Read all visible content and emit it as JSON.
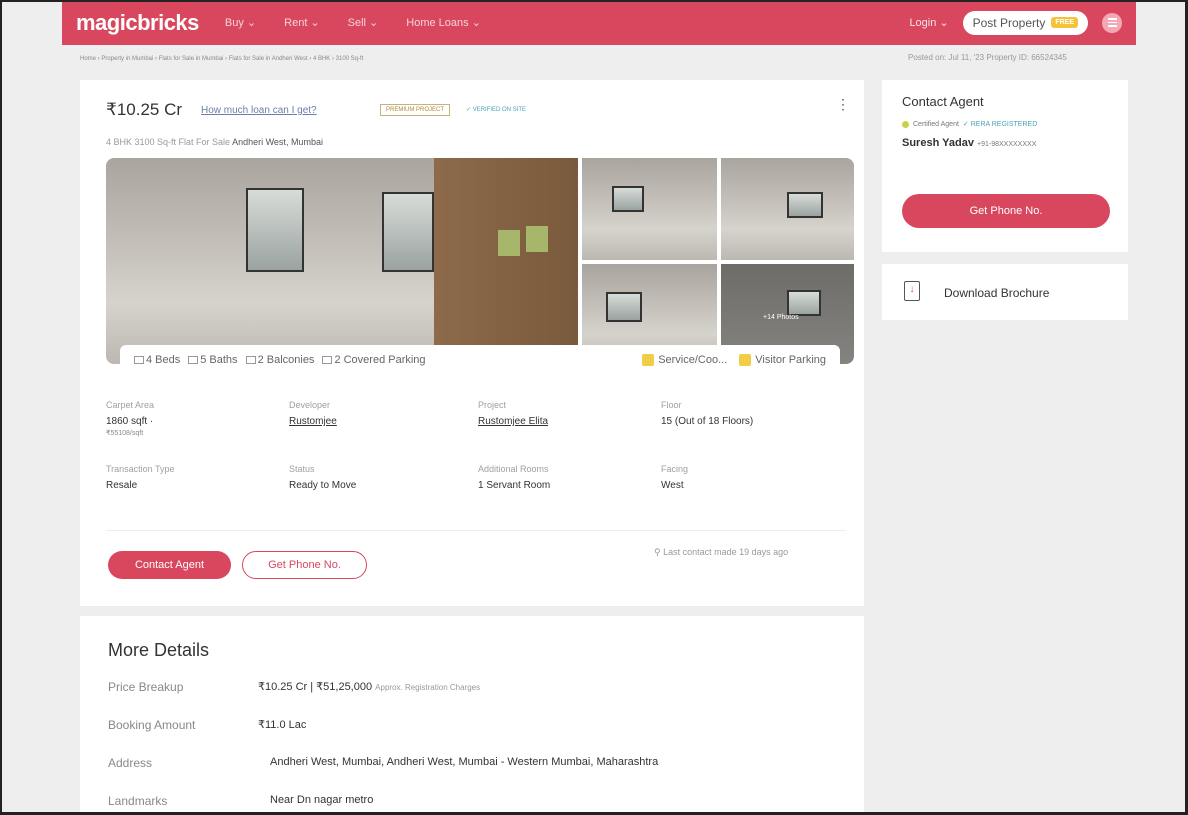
{
  "header": {
    "logo": "magicbricks",
    "nav": [
      "Buy ⌄",
      "Rent ⌄",
      "Sell ⌄",
      "Home Loans ⌄"
    ],
    "login": "Login ⌄",
    "post_property": "Post Property",
    "free_badge": "FREE"
  },
  "breadcrumb": "Home › Property in Mumbai › Flats for Sale in Mumbai › Flats for Sale in Andheri West › 4 BHK › 3100 Sq-ft",
  "posted": "Posted on: Jul 11, '23    Property ID: 66524345",
  "listing": {
    "price": "₹10.25 Cr",
    "loan_link": "How much loan can I get?",
    "premium_badge": "PREMIUM PROJECT",
    "verified_badge": "✓ VERIFIED ON SITE",
    "subtitle_prefix": "4 BHK 3100 Sq-ft Flat For Sale",
    "subtitle_location": "Andheri West, Mumbai",
    "more_photos": "+14 Photos",
    "amenities_left": [
      "4 Beds",
      "5 Baths",
      "2 Balconies",
      "2 Covered Parking"
    ],
    "amenities_right": [
      "Service/Coo...",
      "Visitor Parking"
    ],
    "facts": [
      {
        "label": "Carpet Area",
        "value": "1860 sqft ·",
        "sub": "₹55108/sqft"
      },
      {
        "label": "Developer",
        "value": "Rustomjee"
      },
      {
        "label": "Project",
        "value": "Rustomjee Elita"
      },
      {
        "label": "Floor",
        "value": "15 (Out of 18 Floors)"
      },
      {
        "label": "Transaction Type",
        "value": "Resale"
      },
      {
        "label": "Status",
        "value": "Ready to Move"
      },
      {
        "label": "Additional Rooms",
        "value": "1 Servant Room"
      },
      {
        "label": "Facing",
        "value": "West"
      }
    ],
    "contact_button": "Contact Agent",
    "phone_button": "Get Phone No.",
    "last_contact": "Last contact made 19 days ago"
  },
  "more_details": {
    "title": "More Details",
    "rows": [
      {
        "label": "Price Breakup",
        "value": "₹10.25 Cr | ₹51,25,000",
        "note": "Approx. Registration Charges"
      },
      {
        "label": "Booking Amount",
        "value": "₹11.0 Lac"
      },
      {
        "label": "Address",
        "value": "Andheri West, Mumbai, Andheri West, Mumbai - Western Mumbai, Maharashtra"
      },
      {
        "label": "Landmarks",
        "value": "Near Dn nagar metro"
      }
    ]
  },
  "sidebar": {
    "title": "Contact Agent",
    "certified": "Certified Agent",
    "rera": "✓ RERA REGISTERED",
    "agent_name": "Suresh Yadav",
    "agent_phone": "+91-98XXXXXXXX",
    "phone_button": "Get Phone No.",
    "brochure": "Download Brochure"
  },
  "colors": {
    "brand": "#d8475e"
  }
}
